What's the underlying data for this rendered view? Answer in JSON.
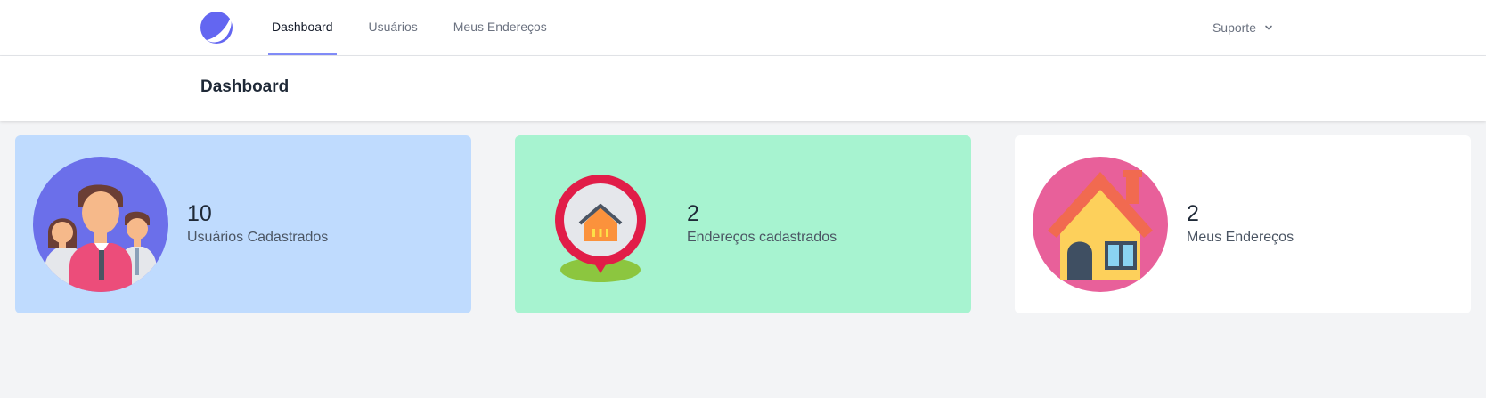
{
  "nav": {
    "links": [
      {
        "label": "Dashboard",
        "active": true
      },
      {
        "label": "Usuários",
        "active": false
      },
      {
        "label": "Meus Endereços",
        "active": false
      }
    ],
    "support_label": "Suporte"
  },
  "header": {
    "title": "Dashboard"
  },
  "cards": [
    {
      "value": "10",
      "label": "Usuários Cadastrados",
      "icon": "users-group-icon",
      "bg": "#bfdbfe"
    },
    {
      "value": "2",
      "label": "Endereços cadastrados",
      "icon": "map-pin-house-icon",
      "bg": "#a7f3d0"
    },
    {
      "value": "2",
      "label": "Meus Endereços",
      "icon": "house-icon",
      "bg": "#ffffff"
    }
  ]
}
